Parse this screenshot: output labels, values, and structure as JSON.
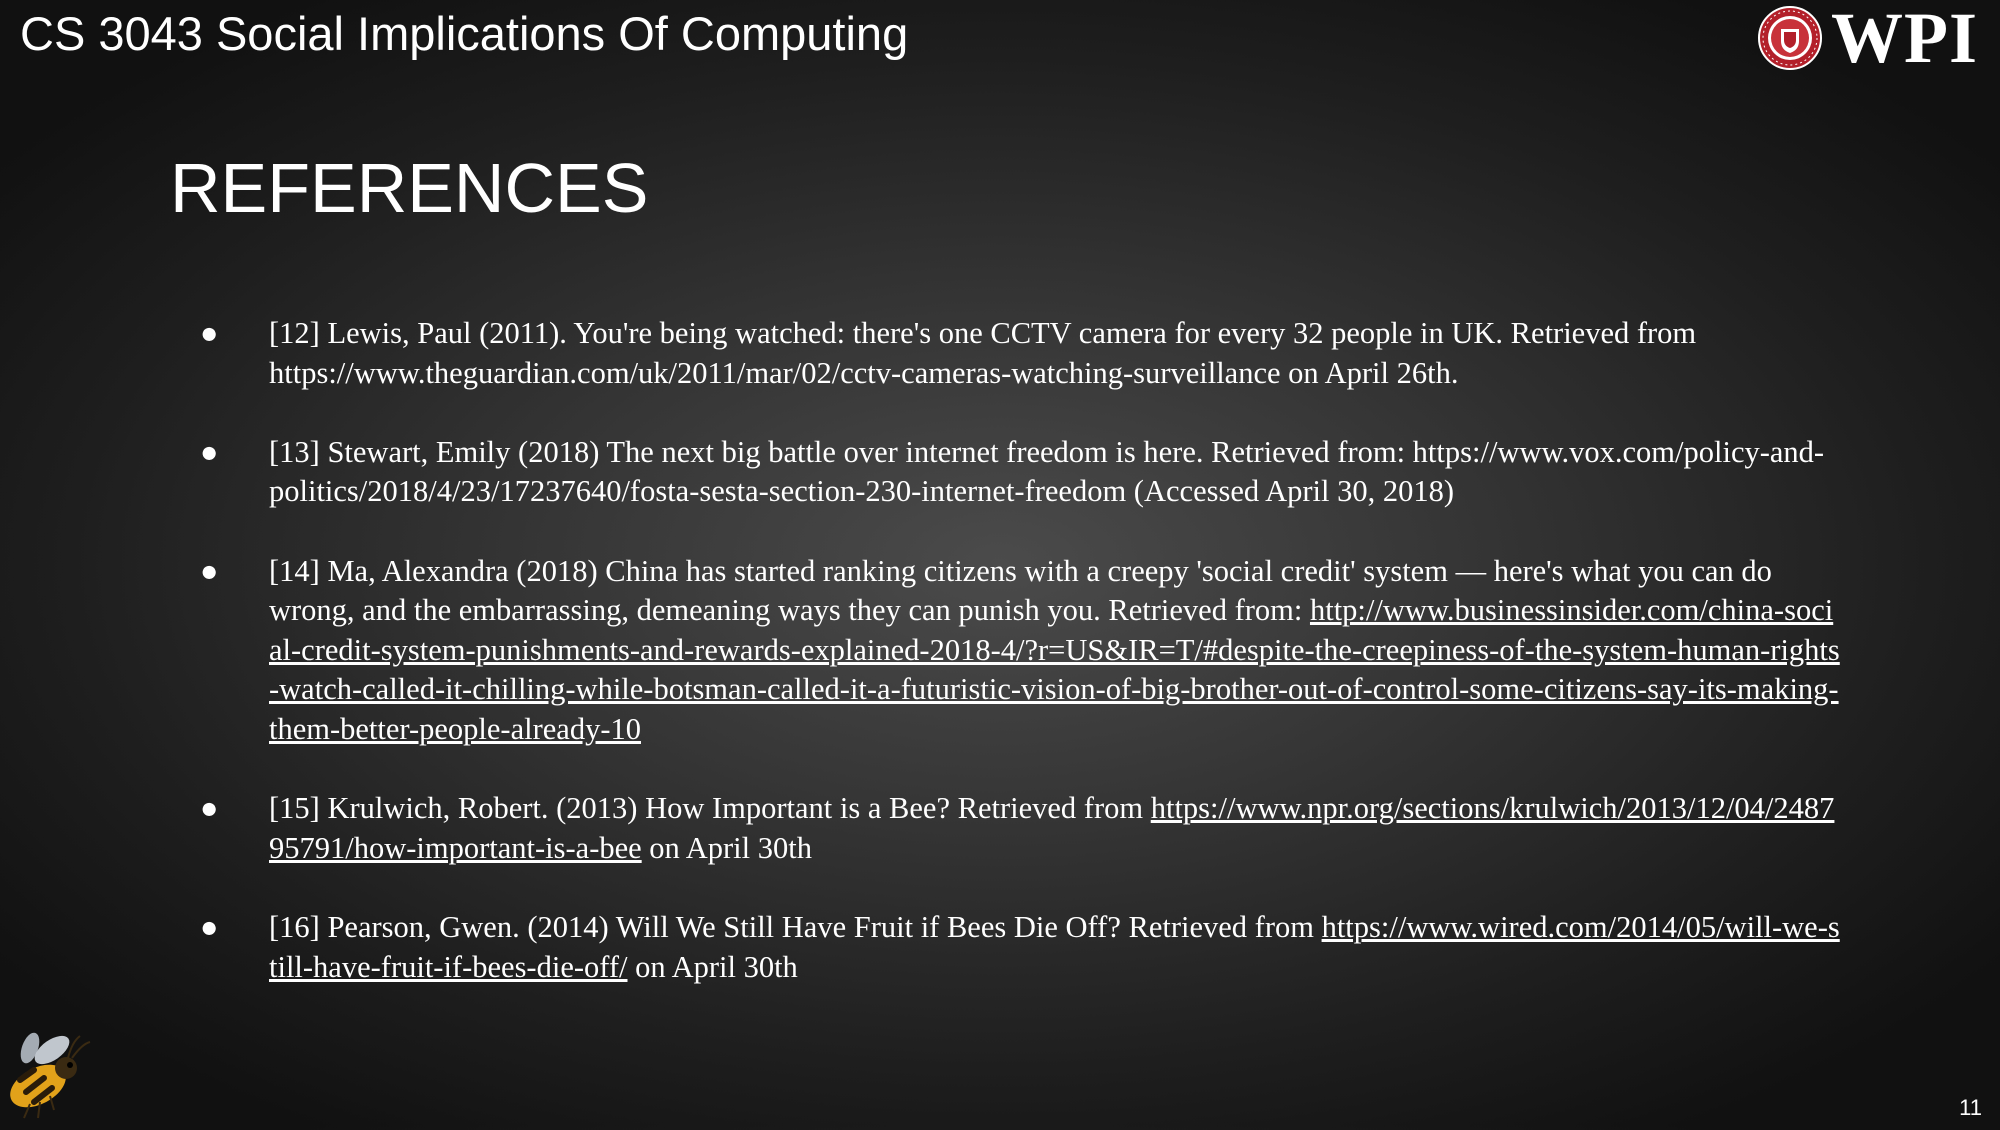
{
  "header": {
    "course_title": "CS 3043 Social Implications Of Computing",
    "logo_text": "WPI"
  },
  "slide": {
    "title": "REFERENCES",
    "page_number": "11"
  },
  "references": [
    {
      "text": "[12] Lewis, Paul (2011). You're being watched: there's one CCTV camera for every 32 people in UK. Retrieved from https://www.theguardian.com/uk/2011/mar/02/cctv-cameras-watching-surveillance on April 26th."
    },
    {
      "text": "[13] Stewart, Emily (2018) The next big battle over internet freedom is here. Retrieved from: https://www.vox.com/policy-and-politics/2018/4/23/17237640/fosta-sesta-section-230-internet-freedom (Accessed April 30, 2018)"
    },
    {
      "text": "[14] Ma, Alexandra (2018) China has started ranking citizens with a creepy 'social credit' system — here's what you can do wrong, and the embarrassing, demeaning ways they can punish you. Retrieved from: ",
      "link": "http://www.businessinsider.com/china-social-credit-system-punishments-and-rewards-explained-2018-4/?r=US&IR=T/#despite-the-creepiness-of-the-system-human-rights-watch-called-it-chilling-while-botsman-called-it-a-futuristic-vision-of-big-brother-out-of-control-some-citizens-say-its-making-them-better-people-already-10"
    },
    {
      "text": "[15] Krulwich, Robert. (2013) How Important is a Bee? Retrieved from ",
      "link": "https://www.npr.org/sections/krulwich/2013/12/04/248795791/how-important-is-a-bee",
      "after": " on April 30th"
    },
    {
      "text": "[16] Pearson, Gwen. (2014) Will We Still Have Fruit if Bees Die Off? Retrieved from ",
      "link": "https://www.wired.com/2014/05/will-we-still-have-fruit-if-bees-die-off/",
      "after": " on April 30th"
    }
  ],
  "icons": {
    "bullet": "●",
    "logo_seal": "university-seal-icon",
    "bee": "bee-icon"
  },
  "colors": {
    "background_center": "#4b4b4b",
    "background_edge": "#111111",
    "text": "#ffffff",
    "seal_red": "#b3202a"
  }
}
